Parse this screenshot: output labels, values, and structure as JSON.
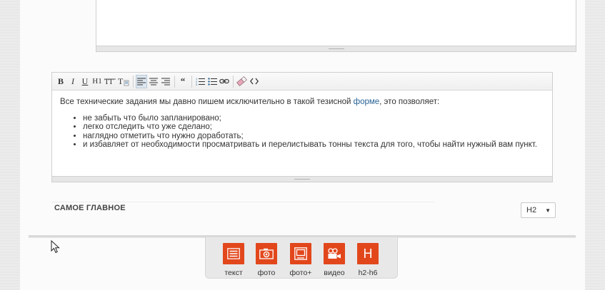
{
  "editor": {
    "toolbar": {
      "bold": "B",
      "italic": "I",
      "underline": "U",
      "heading": "H1",
      "quote": "“"
    },
    "intro_text": "Все технические задания мы давно пишем исключительно в такой тезисной ",
    "intro_link": "форме",
    "intro_suffix": ", это позволяет:",
    "bullets": [
      "не забыть что было запланировано;",
      "легко отследить что уже сделано;",
      "наглядно отметить что нужно доработать;",
      "и избавляет от необходимости просматривать и перелистывать тонны текста для того, чтобы найти нужный вам пункт."
    ]
  },
  "section": {
    "title": "САМОЕ ГЛАВНОЕ",
    "heading_select": "H2"
  },
  "add_panel": {
    "items": [
      {
        "label": "текст",
        "icon": "text-block-icon"
      },
      {
        "label": "фото",
        "icon": "camera-icon"
      },
      {
        "label": "фото+",
        "icon": "gallery-icon"
      },
      {
        "label": "видео",
        "icon": "video-camera-icon"
      },
      {
        "label": "h2-h6",
        "icon": "heading-icon",
        "glyph": "H"
      }
    ],
    "accent_color": "#e2471c"
  }
}
